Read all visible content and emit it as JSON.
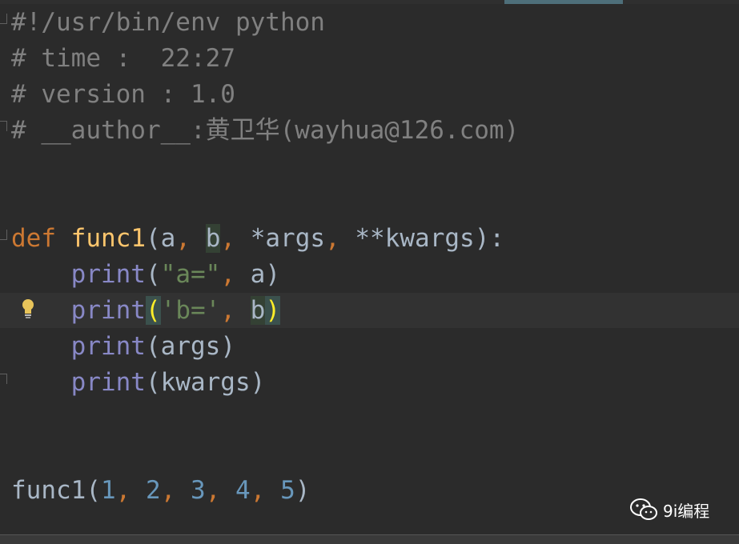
{
  "code": {
    "shebang": "#!/usr/bin/env python",
    "time_comment": "# time :  22:27",
    "version_comment": "# version : 1.0",
    "author_comment": "# __author__:黄卫华(wayhua@126.com)",
    "kw_def": "def",
    "func_name": "func1",
    "p_open": "(",
    "param_a": "a",
    "comma": ",",
    "param_b": "b",
    "param_args": "*args",
    "param_kwargs": "**kwargs",
    "p_close_colon": "):",
    "builtin_print": "print",
    "str_a": "\"a=\"",
    "str_b": "'b='",
    "arg_args": "args",
    "arg_kwargs": "kwargs",
    "call_name": "func1",
    "call_args": [
      "1",
      "2",
      "3",
      "4",
      "5"
    ],
    "p_close": ")"
  },
  "watermark": {
    "icon": "wechat-icon",
    "text": "9i编程"
  },
  "colors": {
    "background": "#2b2b2b",
    "keyword": "#cc7832",
    "function": "#ffc66d",
    "builtin": "#8888c6",
    "string": "#6a8759",
    "number": "#6897bb",
    "comment": "#808080",
    "default": "#a9b7c6"
  }
}
